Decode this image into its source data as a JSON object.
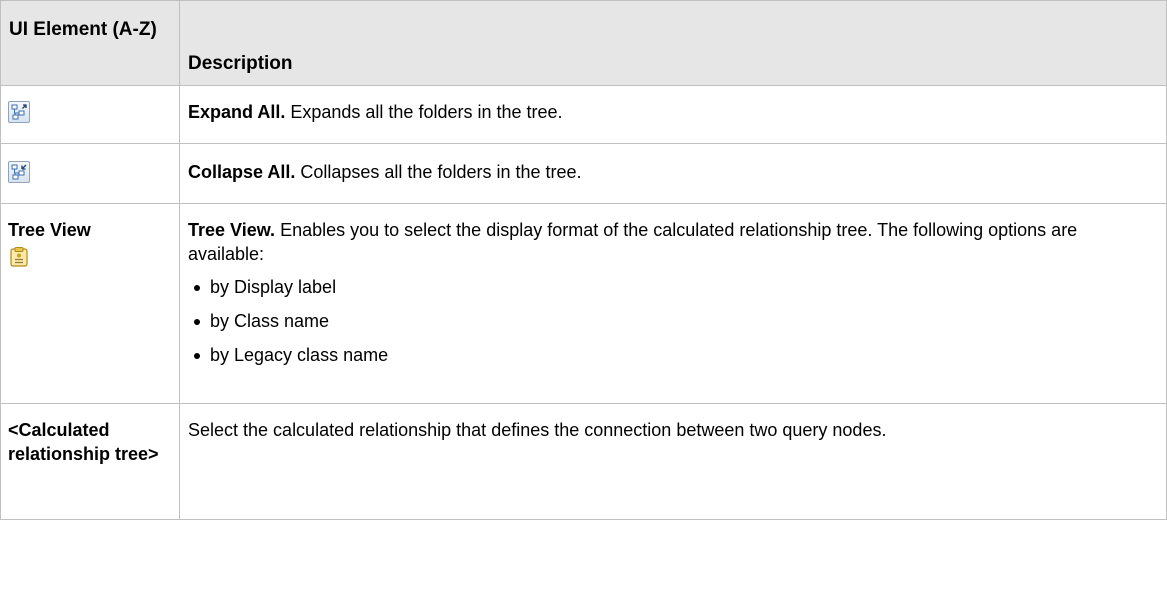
{
  "table": {
    "header": {
      "element_col": "UI Element (A-Z)",
      "description_col": "Description"
    },
    "rows": [
      {
        "icon": "expand-all-icon",
        "title": "Expand All.",
        "text": " Expands all the folders in the tree."
      },
      {
        "icon": "collapse-all-icon",
        "title": "Collapse All.",
        "text": " Collapses all the folders in the tree."
      },
      {
        "element_label": "Tree View",
        "icon": "tree-view-icon",
        "title": "Tree View.",
        "text": " Enables you to select the display format of the calculated relationship tree. The following options are available:",
        "options": [
          "by Display label",
          "by Class name",
          "by Legacy class name"
        ]
      },
      {
        "element_label": "<Calculated relationship tree>",
        "text": "Select the calculated relationship that defines the connection between two query nodes."
      }
    ]
  },
  "colors": {
    "header_bg": "#e6e6e6",
    "border": "#c0c0c0",
    "icon_blue": "#3a6fb0",
    "icon_gold": "#c9a227"
  }
}
